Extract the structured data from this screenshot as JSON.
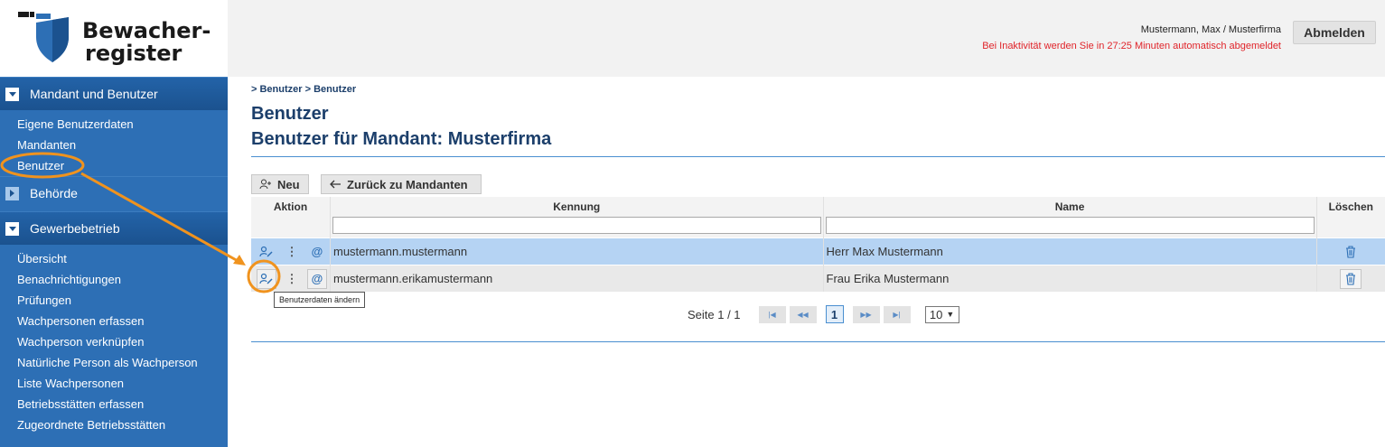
{
  "logo": {
    "line1": "Bewacher-",
    "line2": "register"
  },
  "header": {
    "user": "Mustermann, Max / Musterfirma",
    "inactivity": "Bei Inaktivität werden Sie in 27:25 Minuten automatisch abgemeldet",
    "logout_label": "Abmelden"
  },
  "sidebar": {
    "sections": [
      {
        "label": "Mandant und Benutzer",
        "expanded": true
      },
      {
        "label": "Behörde",
        "expanded": false
      },
      {
        "label": "Gewerbebetrieb",
        "expanded": true
      }
    ],
    "mandant_items": [
      "Eigene Benutzerdaten",
      "Mandanten",
      "Benutzer"
    ],
    "gewerbe_items": [
      "Übersicht",
      "Benachrichtigungen",
      "Prüfungen",
      "Wachpersonen erfassen",
      "Wachperson verknüpfen",
      "Natürliche Person als Wachperson",
      "Liste Wachpersonen",
      "Betriebsstätten erfassen",
      "Zugeordnete Betriebsstätten"
    ]
  },
  "main": {
    "breadcrumb": "> Benutzer > Benutzer",
    "title": "Benutzer",
    "subtitle": "Benutzer für Mandant: Musterfirma",
    "new_label": "Neu",
    "back_label": "Zurück zu Mandanten"
  },
  "table": {
    "headers": {
      "action": "Aktion",
      "kennung": "Kennung",
      "name": "Name",
      "delete": "Löschen"
    },
    "rows": [
      {
        "kennung": "mustermann.mustermann",
        "name": "Herr Max Mustermann"
      },
      {
        "kennung": "mustermann.erikamustermann",
        "name": "Frau Erika Mustermann"
      }
    ],
    "tooltip": "Benutzerdaten ändern"
  },
  "pager": {
    "label": "Seite 1 / 1",
    "current": "1",
    "page_size": "10"
  },
  "colors": {
    "accent": "#2d6fb5",
    "header_blue": "#1b528f",
    "annotation": "#f0931e",
    "warning": "#e0242a"
  },
  "icons": [
    "shield-logo",
    "add-user-icon",
    "arrow-left-icon",
    "edit-user-icon",
    "kebab-icon",
    "at-icon",
    "trash-icon"
  ]
}
